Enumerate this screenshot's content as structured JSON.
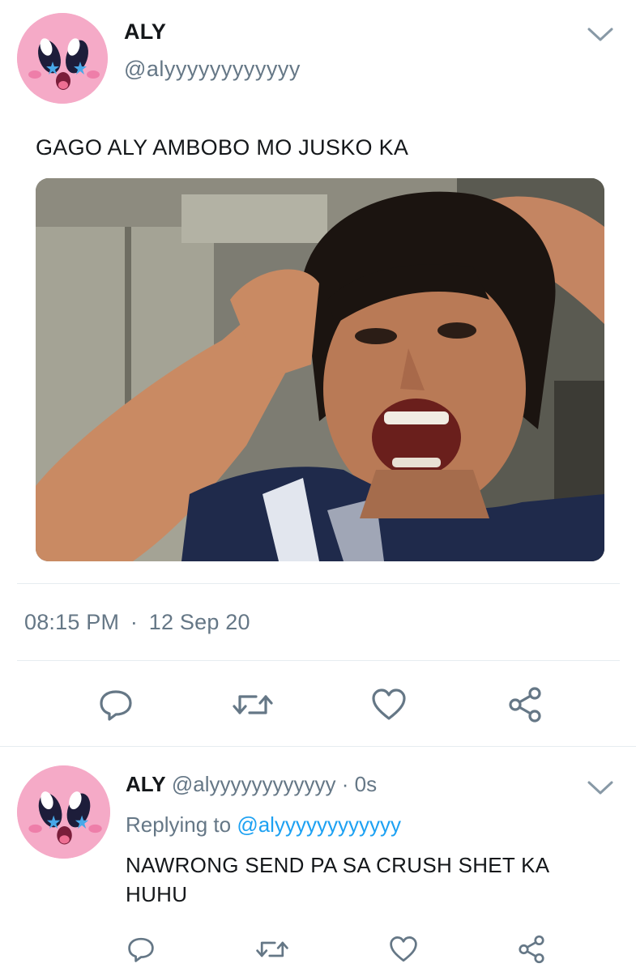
{
  "tweet": {
    "author_name": "ALY",
    "author_handle": "@alyyyyyyyyyyyy",
    "text": "GAGO ALY AMBOBO MO JUSKO KA",
    "time": "08:15 PM",
    "separator": "·",
    "date": "12 Sep 20",
    "avatar_icon": "kirby-face-icon",
    "menu_icon": "chevron-down-icon"
  },
  "actions": {
    "reply_icon": "reply-icon",
    "retweet_icon": "retweet-icon",
    "like_icon": "heart-icon",
    "share_icon": "share-icon"
  },
  "reply": {
    "author_name": "ALY",
    "author_handle": "@alyyyyyyyyyyyy",
    "separator": "·",
    "age": "0s",
    "replying_prefix": "Replying to",
    "replying_to": "@alyyyyyyyyyyyy",
    "text": "NAWRONG SEND PA SA CRUSH SHET KA HUHU"
  },
  "colors": {
    "accent": "#1da1f2",
    "secondary_text": "#657786",
    "primary_text": "#14171a",
    "avatar_pink": "#f4a7c4"
  }
}
